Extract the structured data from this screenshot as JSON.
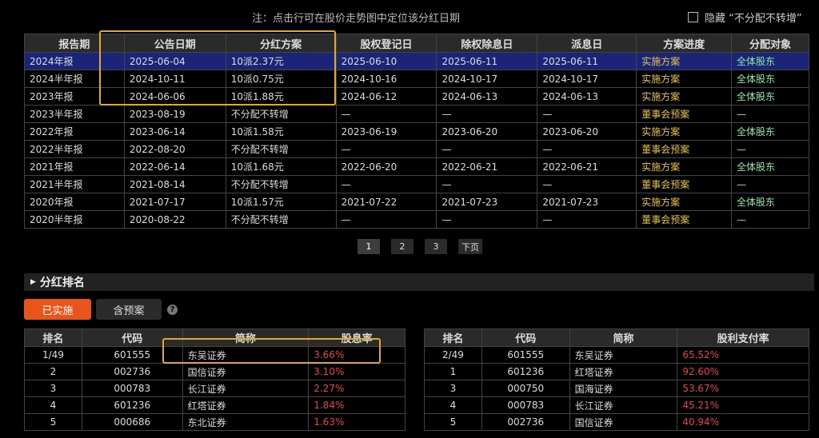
{
  "note": "注：点击行可在股价走势图中定位该分红日期",
  "hide_label": "隐藏 “不分配不转增”",
  "dividend_table": {
    "headers": [
      "报告期",
      "公告日期",
      "分红方案",
      "股权登记日",
      "除权除息日",
      "派息日",
      "方案进度",
      "分配对象"
    ],
    "rows": [
      [
        "2024年报",
        "2025-06-04",
        "10派2.37元",
        "2025-06-10",
        "2025-06-11",
        "2025-06-11",
        "实施方案",
        "全体股东"
      ],
      [
        "2024半年报",
        "2024-10-11",
        "10派0.75元",
        "2024-10-16",
        "2024-10-17",
        "2024-10-17",
        "实施方案",
        "全体股东"
      ],
      [
        "2023年报",
        "2024-06-06",
        "10派1.88元",
        "2024-06-12",
        "2024-06-13",
        "2024-06-13",
        "实施方案",
        "全体股东"
      ],
      [
        "2023半年报",
        "2023-08-19",
        "不分配不转增",
        "—",
        "—",
        "—",
        "董事会预案",
        "—"
      ],
      [
        "2022年报",
        "2023-06-14",
        "10派1.58元",
        "2023-06-19",
        "2023-06-20",
        "2023-06-20",
        "实施方案",
        "全体股东"
      ],
      [
        "2022半年报",
        "2022-08-20",
        "不分配不转增",
        "—",
        "—",
        "—",
        "董事会预案",
        "—"
      ],
      [
        "2021年报",
        "2022-06-14",
        "10派1.68元",
        "2022-06-20",
        "2022-06-21",
        "2022-06-21",
        "实施方案",
        "全体股东"
      ],
      [
        "2021半年报",
        "2021-08-14",
        "不分配不转增",
        "—",
        "—",
        "—",
        "董事会预案",
        "—"
      ],
      [
        "2020年报",
        "2021-07-17",
        "10派1.57元",
        "2021-07-22",
        "2021-07-23",
        "2021-07-23",
        "实施方案",
        "全体股东"
      ],
      [
        "2020半年报",
        "2020-08-22",
        "不分配不转增",
        "—",
        "—",
        "—",
        "董事会预案",
        "—"
      ]
    ]
  },
  "pagination": {
    "pages": [
      "1",
      "2",
      "3"
    ],
    "next": "下页"
  },
  "section_title": "分红排名",
  "tabs": {
    "implemented": "已实施",
    "with_plan": "含预案"
  },
  "help_icon": "?",
  "rank_left": {
    "headers": [
      "排名",
      "代码",
      "简称",
      "股息率"
    ],
    "rows": [
      [
        "1/49",
        "601555",
        "东吴证券",
        "3.66%"
      ],
      [
        "2",
        "002736",
        "国信证券",
        "3.10%"
      ],
      [
        "3",
        "000783",
        "长江证券",
        "2.27%"
      ],
      [
        "4",
        "601236",
        "红塔证券",
        "1.84%"
      ],
      [
        "5",
        "000686",
        "东北证券",
        "1.63%"
      ]
    ]
  },
  "rank_right": {
    "headers": [
      "排名",
      "代码",
      "简称",
      "股利支付率"
    ],
    "rows": [
      [
        "2/49",
        "601555",
        "东吴证券",
        "65.52%"
      ],
      [
        "1",
        "601236",
        "红塔证券",
        "92.60%"
      ],
      [
        "3",
        "000750",
        "国海证券",
        "53.67%"
      ],
      [
        "4",
        "000783",
        "长江证券",
        "45.21%"
      ],
      [
        "5",
        "002736",
        "国信证券",
        "40.94%"
      ]
    ]
  },
  "colors": {
    "accent": "#e8541a",
    "selected_row": "#1a2577",
    "highlight": "#e2a82d",
    "positive": "#e8414a"
  }
}
